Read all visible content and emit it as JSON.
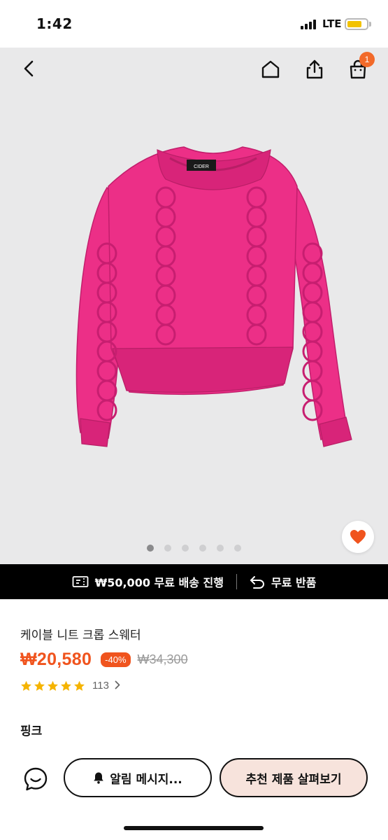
{
  "status_bar": {
    "time": "1:42",
    "network": "LTE",
    "battery_level": 0.75
  },
  "header": {
    "cart_count": "1"
  },
  "gallery": {
    "image_count": 6,
    "active_index": 0,
    "label_text": "CIDER",
    "sweater_color": "#ec2f87"
  },
  "banner": {
    "shipping_text": "₩50,000 무료 배송 진행",
    "returns_text": "무료 반품"
  },
  "product": {
    "title": "케이블 니트 크롭 스웨터",
    "sale_price": "₩20,580",
    "discount": "-40%",
    "original_price": "₩34,300",
    "rating": 5,
    "review_count": "113",
    "color_name": "핑크"
  },
  "actions": {
    "alert_label": "알림 메시지...",
    "recommend_label": "추천 제품 살펴보기"
  },
  "colors": {
    "accent": "#f0541e",
    "recommend_bg": "#f7e3dc",
    "star": "#f5b400"
  }
}
